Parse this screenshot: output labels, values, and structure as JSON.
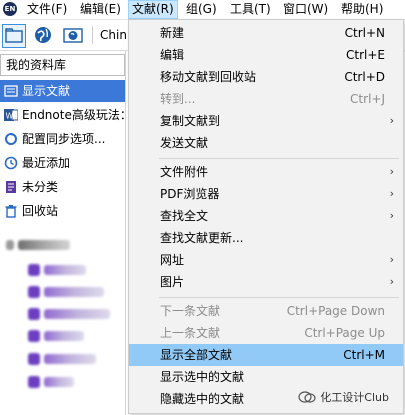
{
  "menubar": {
    "logo": "EN",
    "items": [
      {
        "label": "文件(F)"
      },
      {
        "label": "编辑(E)"
      },
      {
        "label": "文献(R)"
      },
      {
        "label": "组(G)"
      },
      {
        "label": "工具(T)"
      },
      {
        "label": "窗口(W)"
      },
      {
        "label": "帮助(H)"
      }
    ]
  },
  "toolbar": {
    "partial_text": "Chin",
    "icons": [
      "folder-icon",
      "globe-icon",
      "globe-sync-icon"
    ]
  },
  "library": {
    "select_value": "我的资料库",
    "groups": [
      {
        "label": "显示文献",
        "icon": "all-references-icon"
      },
      {
        "label": "Endnote高级玩法：",
        "icon": "word-doc-icon"
      },
      {
        "label": "配置同步选项...",
        "icon": "sync-icon"
      },
      {
        "label": "最近添加",
        "icon": "clock-icon"
      },
      {
        "label": "未分类",
        "icon": "unfiled-icon"
      },
      {
        "label": "回收站",
        "icon": "trash-icon"
      }
    ]
  },
  "dropdown": {
    "items": [
      {
        "label": "新建",
        "shortcut": "Ctrl+N"
      },
      {
        "label": "编辑",
        "shortcut": "Ctrl+E"
      },
      {
        "label": "移动文献到回收站",
        "shortcut": "Ctrl+D"
      },
      {
        "label": "转到...",
        "shortcut": "Ctrl+J"
      },
      {
        "label": "复制文献到",
        "shortcut": ""
      },
      {
        "label": "发送文献",
        "shortcut": ""
      },
      {
        "label": "文件附件",
        "shortcut": ""
      },
      {
        "label": "PDF浏览器",
        "shortcut": ""
      },
      {
        "label": "查找全文",
        "shortcut": ""
      },
      {
        "label": "查找文献更新...",
        "shortcut": ""
      },
      {
        "label": "网址",
        "shortcut": ""
      },
      {
        "label": "图片",
        "shortcut": ""
      },
      {
        "label": "下一条文献",
        "shortcut": "Ctrl+Page Down"
      },
      {
        "label": "上一条文献",
        "shortcut": "Ctrl+Page Up"
      },
      {
        "label": "显示全部文献",
        "shortcut": "Ctrl+M"
      },
      {
        "label": "显示选中的文献",
        "shortcut": ""
      },
      {
        "label": "隐藏选中的文献",
        "shortcut": ""
      }
    ]
  },
  "watermark": {
    "text": "化工设计Club"
  },
  "colors": {
    "selected_group": "#3b78d7",
    "menu_highlight": "#91c9f7",
    "active_menu": "#cce8ff"
  }
}
